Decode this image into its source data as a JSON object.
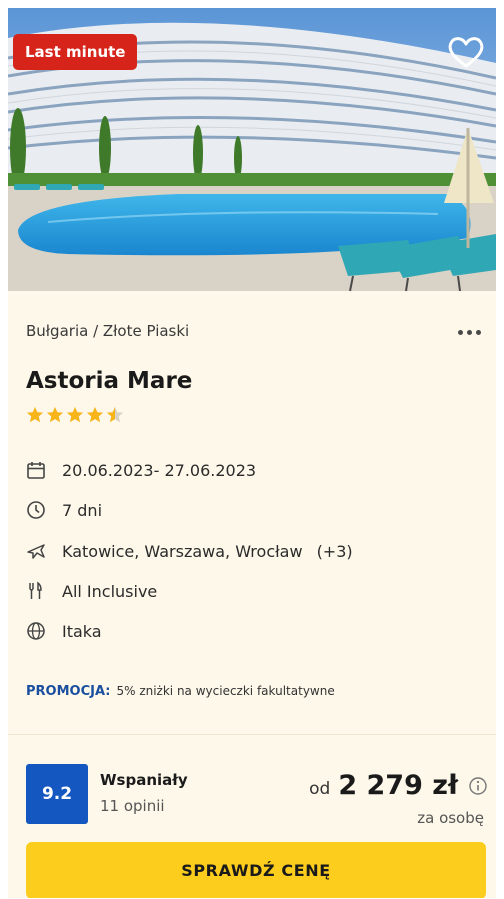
{
  "offer": {
    "badge": "Last minute",
    "location": "Bułgaria / Złote Piaski",
    "hotel_name": "Astoria Mare",
    "star_rating": 4.5,
    "star_max": 5,
    "dates": "20.06.2023- 27.06.2023",
    "duration": "7 dni",
    "departures": "Katowice, Warszawa, Wrocław",
    "departures_more": "(+3)",
    "board": "All Inclusive",
    "operator": "Itaka",
    "promo_label": "PROMOCJA:",
    "promo_text": "5% zniżki na wycieczki fakultatywne",
    "score": "9.2",
    "score_word": "Wspaniały",
    "reviews": "11 opinii",
    "price_prefix": "od",
    "price": "2 279 zł",
    "price_unit": "za osobę",
    "cta": "SPRAWDŹ CENĘ"
  },
  "icons": {
    "heart": "heart-icon",
    "more": "more-dots-icon",
    "star": "star-icon",
    "calendar": "calendar-icon",
    "clock": "clock-icon",
    "plane": "plane-icon",
    "food": "cutlery-icon",
    "globe": "globe-icon",
    "info": "info-icon"
  },
  "colors": {
    "badge_bg": "#d6241a",
    "card_bg": "#fdf8ea",
    "score_bg": "#1557c0",
    "promo_label": "#1a4fa0",
    "cta_bg": "#fdcd1e",
    "star": "#f7b519"
  }
}
